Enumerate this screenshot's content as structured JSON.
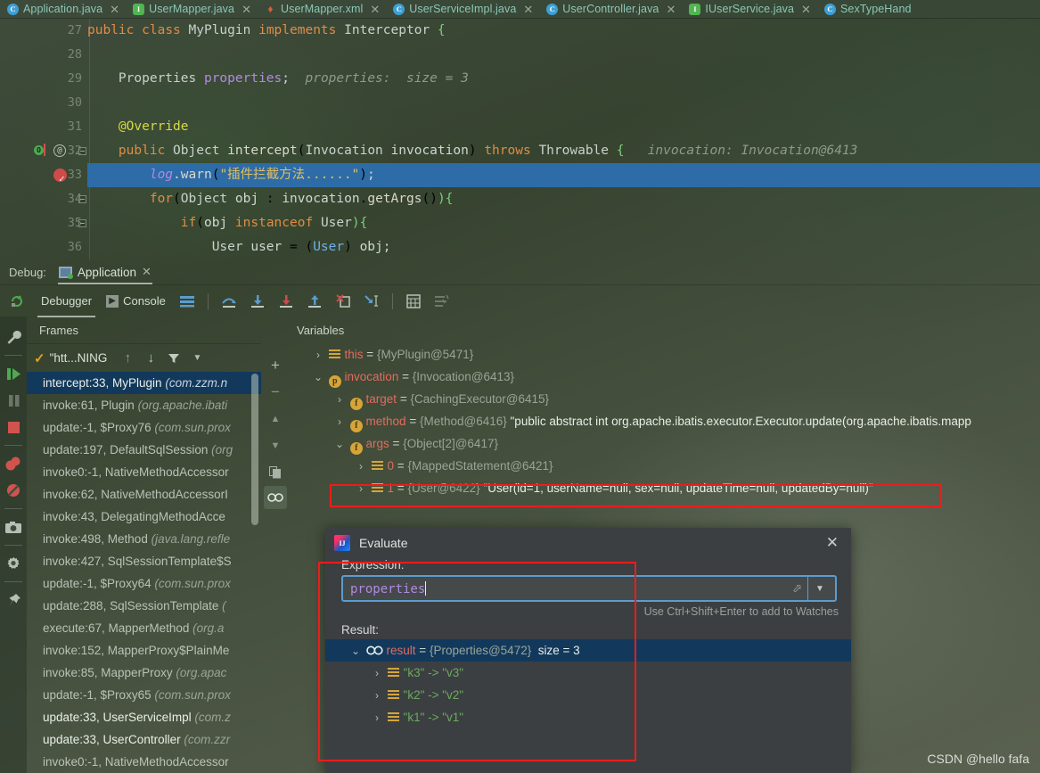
{
  "tabs": [
    {
      "label": "Application.java",
      "icon": "class-icon",
      "icon_kind": "c"
    },
    {
      "label": "UserMapper.java",
      "icon": "interface-icon",
      "icon_kind": "i"
    },
    {
      "label": "UserMapper.xml",
      "icon": "xml-file-icon",
      "icon_kind": "xml"
    },
    {
      "label": "UserServiceImpl.java",
      "icon": "class-icon",
      "icon_kind": "c"
    },
    {
      "label": "UserController.java",
      "icon": "class-icon",
      "icon_kind": "c"
    },
    {
      "label": "IUserService.java",
      "icon": "interface-icon",
      "icon_kind": "i"
    },
    {
      "label": "SexTypeHand",
      "icon": "class-icon",
      "icon_kind": "c"
    }
  ],
  "editor": {
    "lines": [
      {
        "num": "27",
        "text": "public class MyPlugin implements Interceptor {"
      },
      {
        "num": "28",
        "text": ""
      },
      {
        "num": "29",
        "text": "    Properties properties;",
        "hint": "properties:  size = 3"
      },
      {
        "num": "30",
        "text": ""
      },
      {
        "num": "31",
        "text": "    @Override"
      },
      {
        "num": "32",
        "text": "    public Object intercept(Invocation invocation) throws Throwable {",
        "hint": "invocation: Invocation@6413"
      },
      {
        "num": "33",
        "text": "        log.warn(\"插件拦截方法......\");",
        "highlighted": true
      },
      {
        "num": "34",
        "text": "        for(Object obj : invocation.getArgs()){"
      },
      {
        "num": "35",
        "text": "            if(obj instanceof User){"
      },
      {
        "num": "36",
        "text": "                User user = (User) obj;"
      }
    ]
  },
  "debug": {
    "header_label": "Debug:",
    "run_config": "Application",
    "tabs": [
      {
        "label": "Debugger",
        "active": true
      },
      {
        "label": "Console",
        "active": false
      }
    ],
    "toolbar_icons": [
      "rerun-icon",
      "layout-icon",
      "step-over-icon",
      "step-into-icon",
      "force-step-into-icon",
      "step-out-icon",
      "drop-frame-icon",
      "run-to-cursor-icon",
      "evaluate-expression-icon",
      "settings-icon"
    ],
    "rail_icons": [
      "wrench-icon",
      "resume-program-icon",
      "pause-program-icon",
      "stop-icon",
      "view-breakpoints-icon",
      "mute-breakpoints-icon",
      "camera-icon",
      "settings-gear-icon",
      "pin-icon"
    ],
    "frames": {
      "title": "Frames",
      "thread": "\"htt...NING",
      "controls": [
        "check-icon",
        "arrow-up-icon",
        "arrow-down-icon",
        "filter-icon",
        "chevron-down-icon"
      ],
      "items": [
        {
          "method": "intercept:33, MyPlugin ",
          "pkg": "(com.zzm.n",
          "selected": true
        },
        {
          "method": "invoke:61, Plugin ",
          "pkg": "(org.apache.ibati"
        },
        {
          "method": "update:-1, $Proxy76 ",
          "pkg": "(com.sun.prox"
        },
        {
          "method": "update:197, DefaultSqlSession ",
          "pkg": "(org"
        },
        {
          "method": "invoke0:-1, NativeMethodAccessor",
          "pkg": ""
        },
        {
          "method": "invoke:62, NativeMethodAccessorI",
          "pkg": ""
        },
        {
          "method": "invoke:43, DelegatingMethodAcce",
          "pkg": ""
        },
        {
          "method": "invoke:498, Method ",
          "pkg": "(java.lang.refle"
        },
        {
          "method": "invoke:427, SqlSessionTemplate$S",
          "pkg": ""
        },
        {
          "method": "update:-1, $Proxy64 ",
          "pkg": "(com.sun.prox"
        },
        {
          "method": "update:288, SqlSessionTemplate ",
          "pkg": "("
        },
        {
          "method": "execute:67, MapperMethod ",
          "pkg": "(org.a"
        },
        {
          "method": "invoke:152, MapperProxy$PlainMe",
          "pkg": ""
        },
        {
          "method": "invoke:85, MapperProxy ",
          "pkg": "(org.apac"
        },
        {
          "method": "update:-1, $Proxy65 ",
          "pkg": "(com.sun.prox"
        },
        {
          "method": "update:33, UserServiceImpl ",
          "pkg": "(com.z",
          "bold": true
        },
        {
          "method": "update:33, UserController ",
          "pkg": "(com.zzr",
          "bold": true
        },
        {
          "method": "invoke0:-1, NativeMethodAccessor",
          "pkg": ""
        }
      ]
    },
    "variables": {
      "title": "Variables",
      "side_icons": [
        "add-watch-icon",
        "remove-watch-icon",
        "move-up-icon",
        "move-down-icon",
        "copy-icon",
        "inspect-icon"
      ],
      "rows": [
        {
          "indent": 0,
          "chev": "›",
          "icon": "array-icon",
          "name": "this",
          "eq": " = ",
          "ref": "{MyPlugin@5471}",
          "str": ""
        },
        {
          "indent": 0,
          "chev": "⌄",
          "icon": "param-icon",
          "name": "invocation",
          "eq": " = ",
          "ref": "{Invocation@6413}",
          "str": ""
        },
        {
          "indent": 1,
          "chev": "›",
          "icon": "field-icon",
          "name": "target",
          "eq": " = ",
          "ref": "{CachingExecutor@6415}",
          "str": ""
        },
        {
          "indent": 1,
          "chev": "›",
          "icon": "field-icon",
          "name": "method",
          "eq": " = ",
          "ref": "{Method@6416}",
          "str": "\"public abstract int org.apache.ibatis.executor.Executor.update(org.apache.ibatis.mapp"
        },
        {
          "indent": 1,
          "chev": "⌄",
          "icon": "field-icon",
          "name": "args",
          "eq": " = ",
          "ref": "{Object[2]@6417}",
          "str": ""
        },
        {
          "indent": 2,
          "chev": "›",
          "icon": "array-icon",
          "name": "0",
          "eq": " = ",
          "ref": "{MappedStatement@6421}",
          "str": ""
        },
        {
          "indent": 2,
          "chev": "›",
          "icon": "array-icon",
          "name": "1",
          "eq": " = ",
          "ref": "{User@6422}",
          "str": "\"User(id=1, userName=null, sex=null, updateTime=null, updatedBy=null)\"",
          "highlighted": true
        }
      ]
    }
  },
  "evaluate": {
    "title": "Evaluate",
    "close_label": "✕",
    "expression_label": "Expression:",
    "expression_value": "properties",
    "hint": "Use Ctrl+Shift+Enter to add to Watches",
    "result_label": "Result:",
    "result_row": {
      "chev": "⌄",
      "name": "result",
      "eq": " = ",
      "ref": "{Properties@5472}",
      "size": "size = 3"
    },
    "entries": [
      {
        "chev": "›",
        "text": "\"k3\" -> \"v3\""
      },
      {
        "chev": "›",
        "text": "\"k2\" -> \"v2\""
      },
      {
        "chev": "›",
        "text": "\"k1\" -> \"v1\""
      }
    ]
  },
  "watermark": "CSDN @hello fafa",
  "colors": {
    "accent_red": "#ee1c1c",
    "selection_blue": "#2e6ca8",
    "row_select": "#12395c",
    "field_focus": "#5c9ccf"
  }
}
